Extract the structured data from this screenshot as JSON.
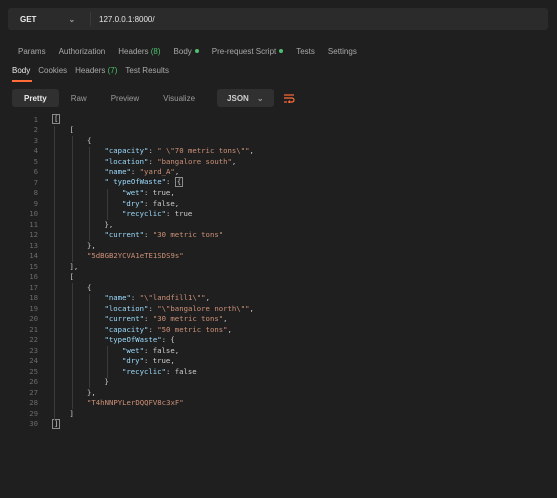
{
  "request": {
    "method": "GET",
    "url": "127.0.0.1:8000/"
  },
  "request_tabs": [
    {
      "label": "Params"
    },
    {
      "label": "Authorization"
    },
    {
      "label": "Headers",
      "count": "(8)"
    },
    {
      "label": "Body",
      "dot": true
    },
    {
      "label": "Pre-request Script",
      "dot": true
    },
    {
      "label": "Tests"
    },
    {
      "label": "Settings"
    }
  ],
  "response_tabs": [
    {
      "label": "Body",
      "active": true
    },
    {
      "label": "Cookies"
    },
    {
      "label": "Headers",
      "count": "(7)"
    },
    {
      "label": "Test Results"
    }
  ],
  "toolbar": {
    "pretty": "Pretty",
    "raw": "Raw",
    "preview": "Preview",
    "visualize": "Visualize",
    "format": "JSON",
    "wrap_icon": "wrap-lines-icon"
  },
  "colors": {
    "accent": "#ff6c37",
    "green": "#4fc16e",
    "key": "#9cdcfe",
    "string": "#ce9178"
  },
  "code_lines": [
    {
      "n": "1",
      "indent": 0,
      "tokens": [
        [
          "b",
          "["
        ]
      ]
    },
    {
      "n": "2",
      "indent": 1,
      "tokens": [
        [
          "p",
          "["
        ]
      ]
    },
    {
      "n": "3",
      "indent": 2,
      "tokens": [
        [
          "p",
          "{"
        ]
      ]
    },
    {
      "n": "4",
      "indent": 3,
      "tokens": [
        [
          "k",
          "\"capacity\""
        ],
        [
          "p",
          ": "
        ],
        [
          "s",
          "\" \\\"70 metric tons\\\"\""
        ],
        [
          "p",
          ","
        ]
      ]
    },
    {
      "n": "5",
      "indent": 3,
      "tokens": [
        [
          "k",
          "\"location\""
        ],
        [
          "p",
          ": "
        ],
        [
          "s",
          "\"bangalore south\""
        ],
        [
          "p",
          ","
        ]
      ]
    },
    {
      "n": "6",
      "indent": 3,
      "tokens": [
        [
          "k",
          "\"name\""
        ],
        [
          "p",
          ": "
        ],
        [
          "s",
          "\"yard_A\""
        ],
        [
          "p",
          ","
        ]
      ]
    },
    {
      "n": "7",
      "indent": 3,
      "tokens": [
        [
          "k",
          "\" typeOfWaste\""
        ],
        [
          "p",
          ": "
        ],
        [
          "b",
          "{"
        ]
      ]
    },
    {
      "n": "8",
      "indent": 4,
      "tokens": [
        [
          "k",
          "\"wet\""
        ],
        [
          "p",
          ": true,"
        ]
      ]
    },
    {
      "n": "9",
      "indent": 4,
      "tokens": [
        [
          "k",
          "\"dry\""
        ],
        [
          "p",
          ": false,"
        ]
      ]
    },
    {
      "n": "10",
      "indent": 4,
      "tokens": [
        [
          "k",
          "\"recyclic\""
        ],
        [
          "p",
          ": true"
        ]
      ]
    },
    {
      "n": "11",
      "indent": 3,
      "tokens": [
        [
          "p",
          "},"
        ]
      ]
    },
    {
      "n": "12",
      "indent": 3,
      "tokens": [
        [
          "k",
          "\"current\""
        ],
        [
          "p",
          ": "
        ],
        [
          "s",
          "\"30 metric tons\""
        ]
      ]
    },
    {
      "n": "13",
      "indent": 2,
      "tokens": [
        [
          "p",
          "},"
        ]
      ]
    },
    {
      "n": "14",
      "indent": 2,
      "tokens": [
        [
          "s",
          "\"5dBGB2YCVA1eTE1SDS9s\""
        ]
      ]
    },
    {
      "n": "15",
      "indent": 1,
      "tokens": [
        [
          "p",
          "],"
        ]
      ]
    },
    {
      "n": "16",
      "indent": 1,
      "tokens": [
        [
          "p",
          "["
        ]
      ]
    },
    {
      "n": "17",
      "indent": 2,
      "tokens": [
        [
          "p",
          "{"
        ]
      ]
    },
    {
      "n": "18",
      "indent": 3,
      "tokens": [
        [
          "k",
          "\"name\""
        ],
        [
          "p",
          ": "
        ],
        [
          "s",
          "\"\\\"landfill1\\\"\""
        ],
        [
          "p",
          ","
        ]
      ]
    },
    {
      "n": "19",
      "indent": 3,
      "tokens": [
        [
          "k",
          "\"location\""
        ],
        [
          "p",
          ": "
        ],
        [
          "s",
          "\"\\\"bangalore north\\\"\""
        ],
        [
          "p",
          ","
        ]
      ]
    },
    {
      "n": "20",
      "indent": 3,
      "tokens": [
        [
          "k",
          "\"current\""
        ],
        [
          "p",
          ": "
        ],
        [
          "s",
          "\"30 metric tons\""
        ],
        [
          "p",
          ","
        ]
      ]
    },
    {
      "n": "21",
      "indent": 3,
      "tokens": [
        [
          "k",
          "\"capacity\""
        ],
        [
          "p",
          ": "
        ],
        [
          "s",
          "\"50 metric tons\""
        ],
        [
          "p",
          ","
        ]
      ]
    },
    {
      "n": "22",
      "indent": 3,
      "tokens": [
        [
          "k",
          "\"typeOfWaste\""
        ],
        [
          "p",
          ": {"
        ]
      ]
    },
    {
      "n": "23",
      "indent": 4,
      "tokens": [
        [
          "k",
          "\"wet\""
        ],
        [
          "p",
          ": false,"
        ]
      ]
    },
    {
      "n": "24",
      "indent": 4,
      "tokens": [
        [
          "k",
          "\"dry\""
        ],
        [
          "p",
          ": true,"
        ]
      ]
    },
    {
      "n": "25",
      "indent": 4,
      "tokens": [
        [
          "k",
          "\"recyclic\""
        ],
        [
          "p",
          ": false"
        ]
      ]
    },
    {
      "n": "26",
      "indent": 3,
      "tokens": [
        [
          "p",
          "}"
        ]
      ]
    },
    {
      "n": "27",
      "indent": 2,
      "tokens": [
        [
          "p",
          "},"
        ]
      ]
    },
    {
      "n": "28",
      "indent": 2,
      "tokens": [
        [
          "s",
          "\"T4hNNPYLerDQQFV8c3xF\""
        ]
      ]
    },
    {
      "n": "29",
      "indent": 1,
      "tokens": [
        [
          "p",
          "]"
        ]
      ]
    },
    {
      "n": "30",
      "indent": 0,
      "tokens": [
        [
          "b",
          "]"
        ]
      ]
    }
  ]
}
